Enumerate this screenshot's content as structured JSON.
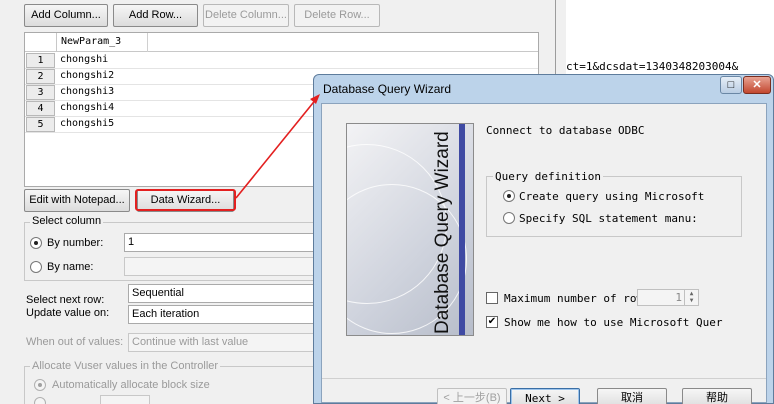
{
  "toolbar": {
    "add_column": "Add Column...",
    "add_row": "Add Row...",
    "delete_column": "Delete Column...",
    "delete_row": "Delete Row..."
  },
  "grid": {
    "column_header": "NewParam_3",
    "rows": [
      {
        "num": "1",
        "value": "chongshi"
      },
      {
        "num": "2",
        "value": "chongshi2"
      },
      {
        "num": "3",
        "value": "chongshi3"
      },
      {
        "num": "4",
        "value": "chongshi4"
      },
      {
        "num": "5",
        "value": "chongshi5"
      }
    ]
  },
  "actions": {
    "edit_notepad": "Edit with Notepad...",
    "data_wizard": "Data Wizard..."
  },
  "select_column": {
    "title": "Select column",
    "by_number": "By number:",
    "by_number_value": "1",
    "by_name": "By name:"
  },
  "settings": {
    "select_next_row_label": "Select next row:",
    "select_next_row_value": "Sequential",
    "update_value_label": "Update value on:",
    "update_value_value": "Each iteration",
    "out_of_values_label": "When out of values:",
    "out_of_values_value": "Continue with last value"
  },
  "allocate": {
    "title": "Allocate Vuser values in the Controller",
    "auto": "Automatically allocate block size"
  },
  "background_url": "ct=1&dcsdat=1340348203004&",
  "dialog": {
    "title": "Database Query Wizard",
    "title_buttons": {
      "min": "–",
      "max": "□",
      "close": "✕"
    },
    "banner_text": "Database Query Wizard",
    "connect_label": "Connect to database",
    "connect_value": "ODBC",
    "query_definition": {
      "title": "Query definition",
      "option_microsoft": "Create query using Microsoft",
      "option_sql": "Specify SQL statement manu:"
    },
    "max_rows_label": "Maximum number of row",
    "max_rows_value": "1",
    "show_me_label": "Show me how to use Microsoft Quer",
    "buttons": {
      "back": "< 上一步(B)",
      "next": "Next >",
      "cancel": "取消",
      "help": "帮助"
    }
  },
  "colors": {
    "annotation": "#e32020",
    "dialog_frame": "#bcd3ea"
  }
}
